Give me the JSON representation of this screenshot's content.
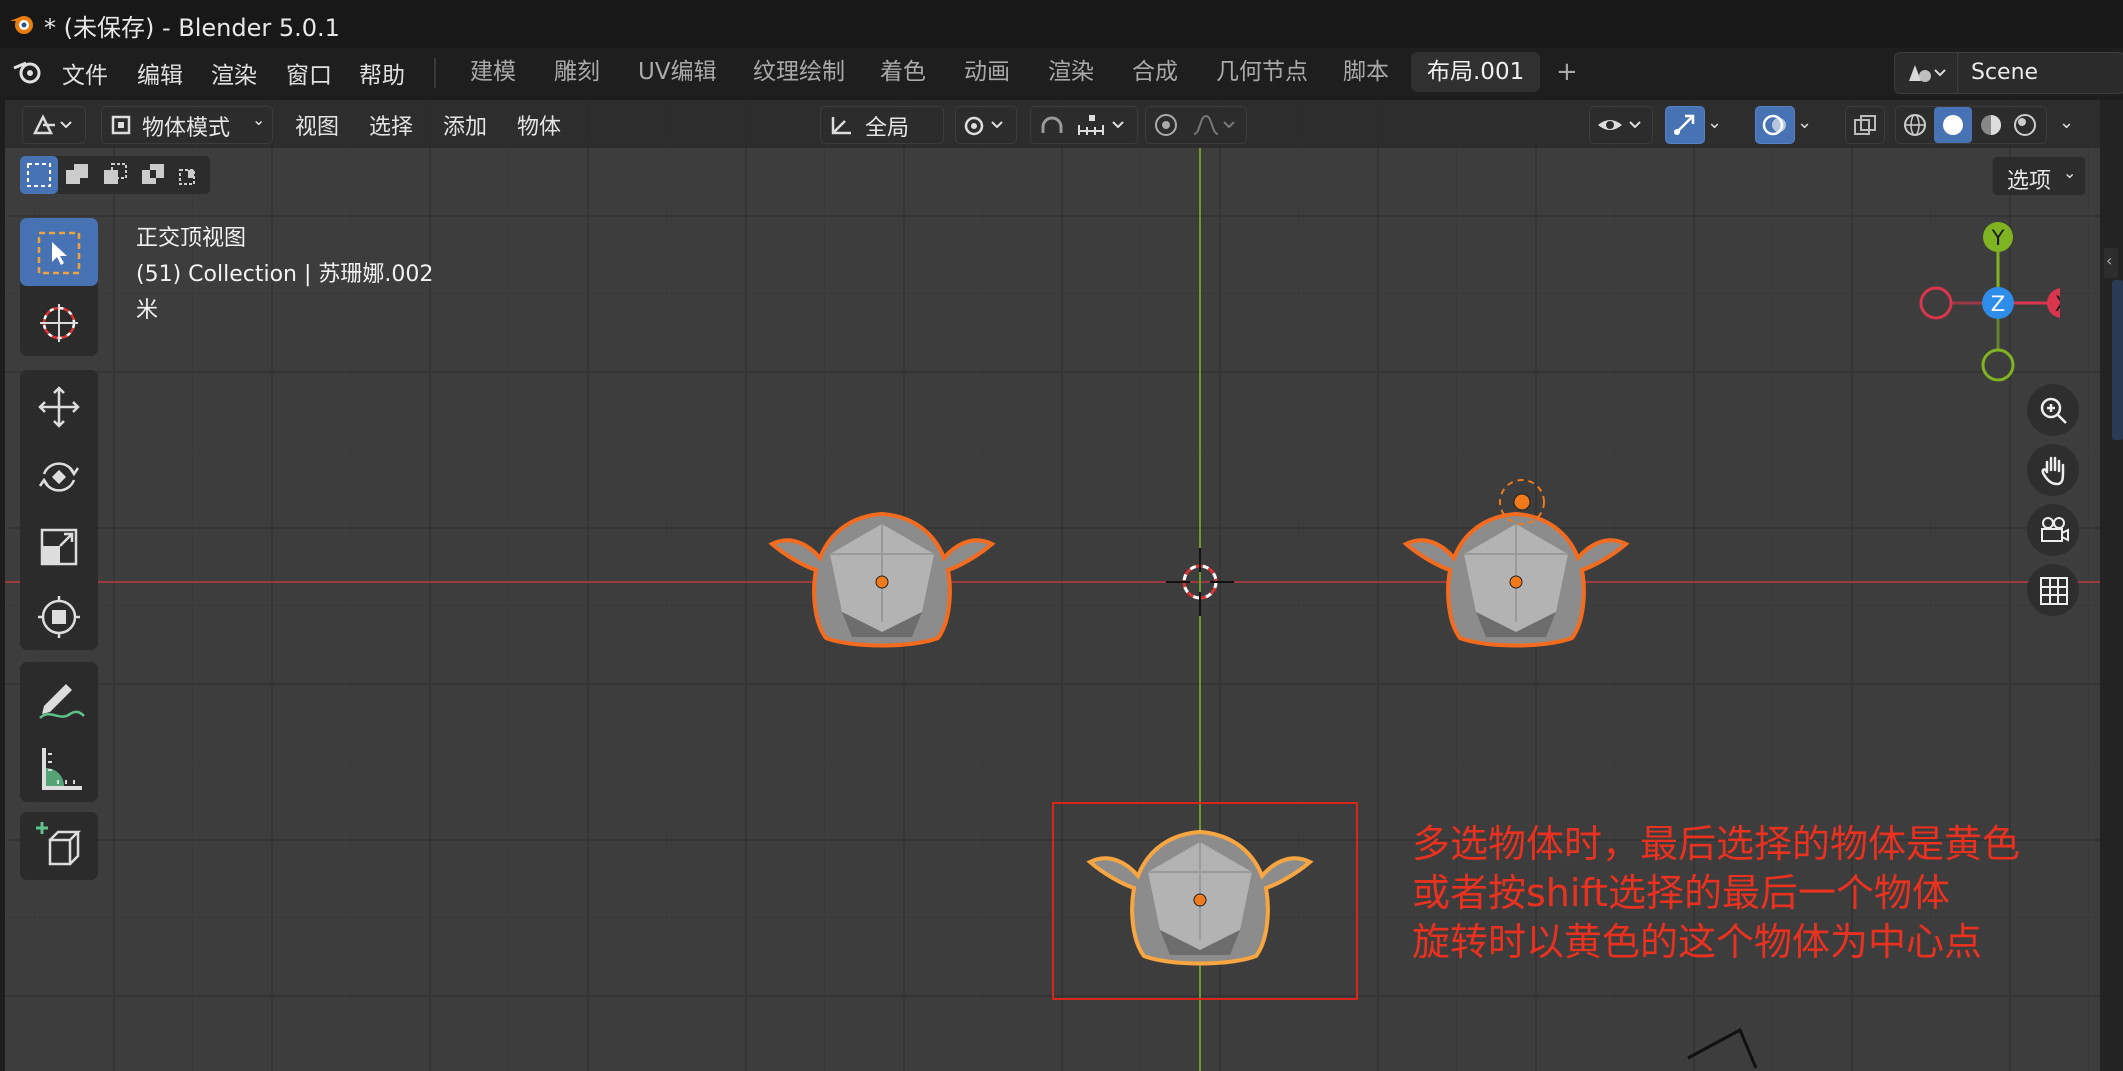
{
  "app": {
    "window_title": "* (未保存) - Blender 5.0.1"
  },
  "menu": {
    "items": [
      "文件",
      "编辑",
      "渲染",
      "窗口",
      "帮助"
    ]
  },
  "workspaces": {
    "tabs": [
      "建模",
      "雕刻",
      "UV编辑",
      "纹理绘制",
      "着色",
      "动画",
      "渲染",
      "合成",
      "几何节点",
      "脚本",
      "布局.001"
    ],
    "active": "布局.001",
    "add_symbol": "+"
  },
  "scene": {
    "name": "Scene"
  },
  "viewport_header": {
    "mode": "物体模式",
    "menus": [
      "视图",
      "选择",
      "添加",
      "物体"
    ],
    "orientation": "全局",
    "options_label": "选项"
  },
  "viewport_info": {
    "view_name": "正交顶视图",
    "collection_line": "(51) Collection | 苏珊娜.002",
    "unit": "米"
  },
  "navigation_gizmo": {
    "y_label": "Y",
    "z_label": "Z",
    "x_label": "X",
    "colors": {
      "x": "#d9354c",
      "y": "#7fb321",
      "z": "#2f8dea"
    }
  },
  "objects": {
    "selection_outline_color": "#f26b1f",
    "active_outline_color": "#f7a641"
  },
  "annotation": {
    "lines": [
      "多选物体时，最后选择的物体是黄色",
      "或者按shift选择的最后一个物体",
      "旋转时以黄色的这个物体为中心点"
    ],
    "color": "#e8311f"
  },
  "tools": [
    "select-box",
    "cursor",
    "move",
    "rotate",
    "scale",
    "transform",
    "annotate",
    "measure",
    "add-cube"
  ]
}
